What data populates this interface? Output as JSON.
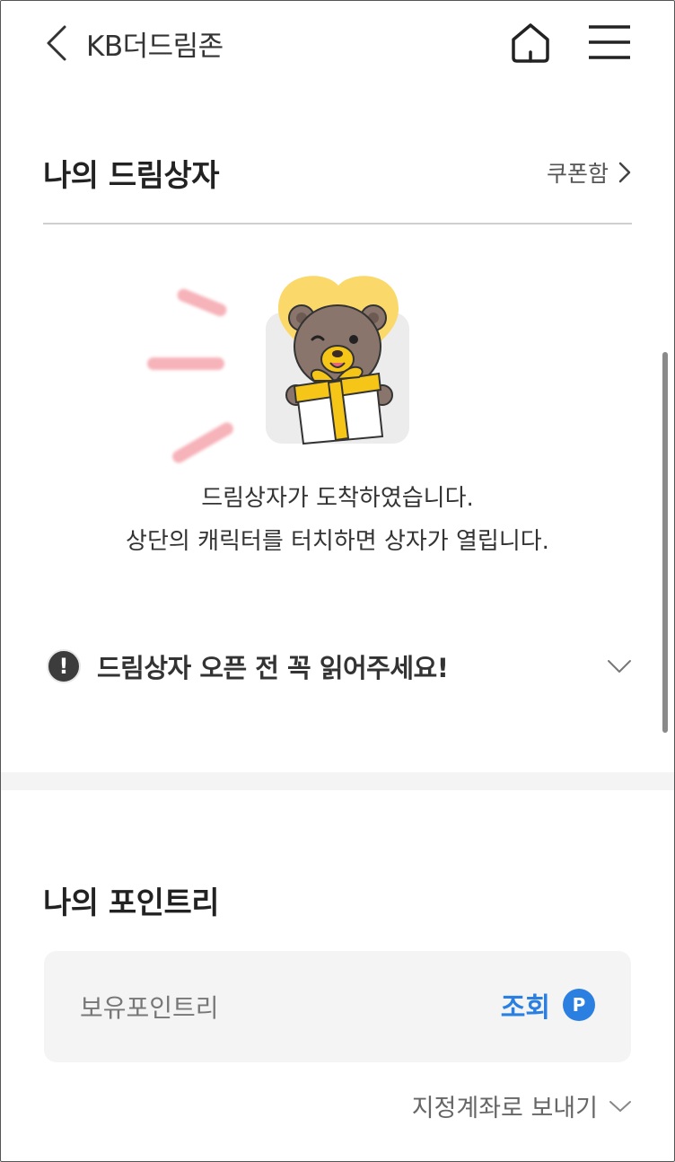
{
  "header": {
    "title": "KB더드림존"
  },
  "dreambox": {
    "title": "나의 드림상자",
    "coupon_link": "쿠폰함",
    "message_line1": "드림상자가 도착하였습니다.",
    "message_line2": "상단의 캐릭터를 터치하면 상자가 열립니다.",
    "notice": "드림상자 오픈 전 꼭 읽어주세요!",
    "notice_icon": "!"
  },
  "pointree": {
    "title": "나의 포인트리",
    "label": "보유포인트리",
    "query_button": "조회",
    "badge": "P",
    "send_link": "지정계좌로 보내기"
  },
  "colors": {
    "accent": "#2a7fe0",
    "bear_brown": "#8a756c",
    "gift_yellow": "#f5c518",
    "heart_yellow": "#fbd86a"
  }
}
